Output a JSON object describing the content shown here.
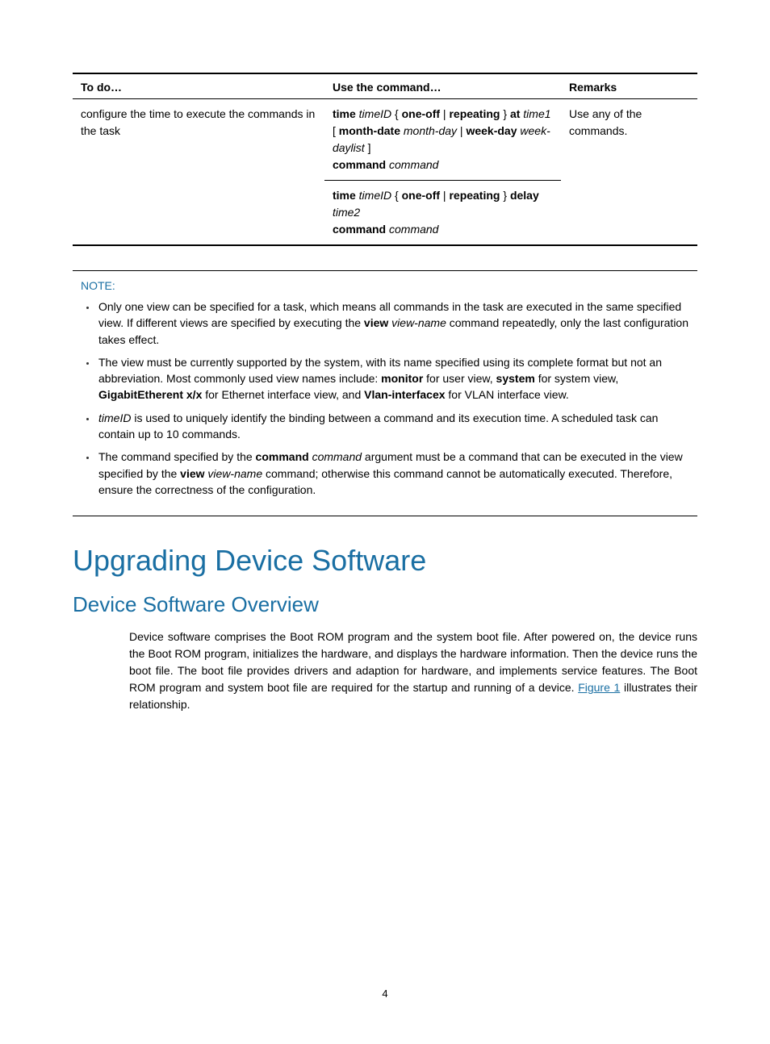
{
  "table": {
    "headers": {
      "todo": "To do…",
      "cmd": "Use the command…",
      "remarks": "Remarks"
    },
    "row": {
      "todo": "configure the time to execute the commands in the task",
      "remarks": "Use any of the commands.",
      "cmd1": {
        "time_kw": "time",
        "timeID": "timeID",
        "brace_open": "{",
        "one_off": "one-off",
        "pipe": "|",
        "repeating": "repeating",
        "brace_close": "}",
        "at_kw": "at",
        "time1": "time1",
        "bracket_open": "[",
        "month_date_kw": "month-date",
        "month_day": "month-day",
        "pipe2": "|",
        "week_day_kw": "week-day",
        "week_daylist": "week-daylist",
        "bracket_close": "]",
        "command_kw": "command",
        "command_val": "command"
      },
      "cmd2": {
        "time_kw": "time",
        "timeID": "timeID",
        "brace_open": "{",
        "one_off": "one-off",
        "pipe": "|",
        "repeating": "repeating",
        "brace_close": "}",
        "delay_kw": "delay",
        "time2": "time2",
        "command_kw": "command",
        "command_val": "command"
      }
    }
  },
  "note": {
    "label": "NOTE:",
    "items": {
      "a": {
        "pre": "Only one view can be specified for a task, which means all commands in the task are executed in the same specified view. If different views are specified by executing the ",
        "view_kw": "view",
        "space": " ",
        "view_name": "view-name",
        "post": " command repeatedly, only the last configuration takes effect."
      },
      "b": {
        "pre": "The view must be currently supported by the system, with its name specified using its complete format but not an abbreviation. Most commonly used view names include: ",
        "monitor": "monitor",
        "s1": " for user view, ",
        "system": "system",
        "s2": " for system view, ",
        "ge": "GigabitEtherent x/x",
        "s3": " for Ethernet interface view, and ",
        "vlan": "Vlan-interfacex",
        "s4": " for VLAN interface view."
      },
      "c": {
        "timeID": "timeID",
        "post": " is used to uniquely identify the binding between a command and its execution time. A scheduled task can contain up to 10 commands."
      },
      "d": {
        "pre": "The command specified by the ",
        "command_kw": "command",
        "space": " ",
        "command_arg": "command",
        "mid": " argument must be a command that can be executed in the view specified by the ",
        "view_kw": "view",
        "space2": " ",
        "view_name": "view-name",
        "post": " command; otherwise this command cannot be automatically executed. Therefore, ensure the correctness of the configuration."
      }
    }
  },
  "heading1": "Upgrading Device Software",
  "heading2": "Device Software Overview",
  "para": {
    "pre": "Device software comprises the Boot ROM program and the system boot file. After powered on, the device runs the Boot ROM program, initializes the hardware, and displays the hardware information. Then the device runs the boot file. The boot file provides drivers and adaption for hardware, and implements service features. The Boot ROM program and system boot file are required for the startup and running of a device. ",
    "figure_link": "Figure 1",
    "post": " illustrates their relationship."
  },
  "page_num": "4"
}
